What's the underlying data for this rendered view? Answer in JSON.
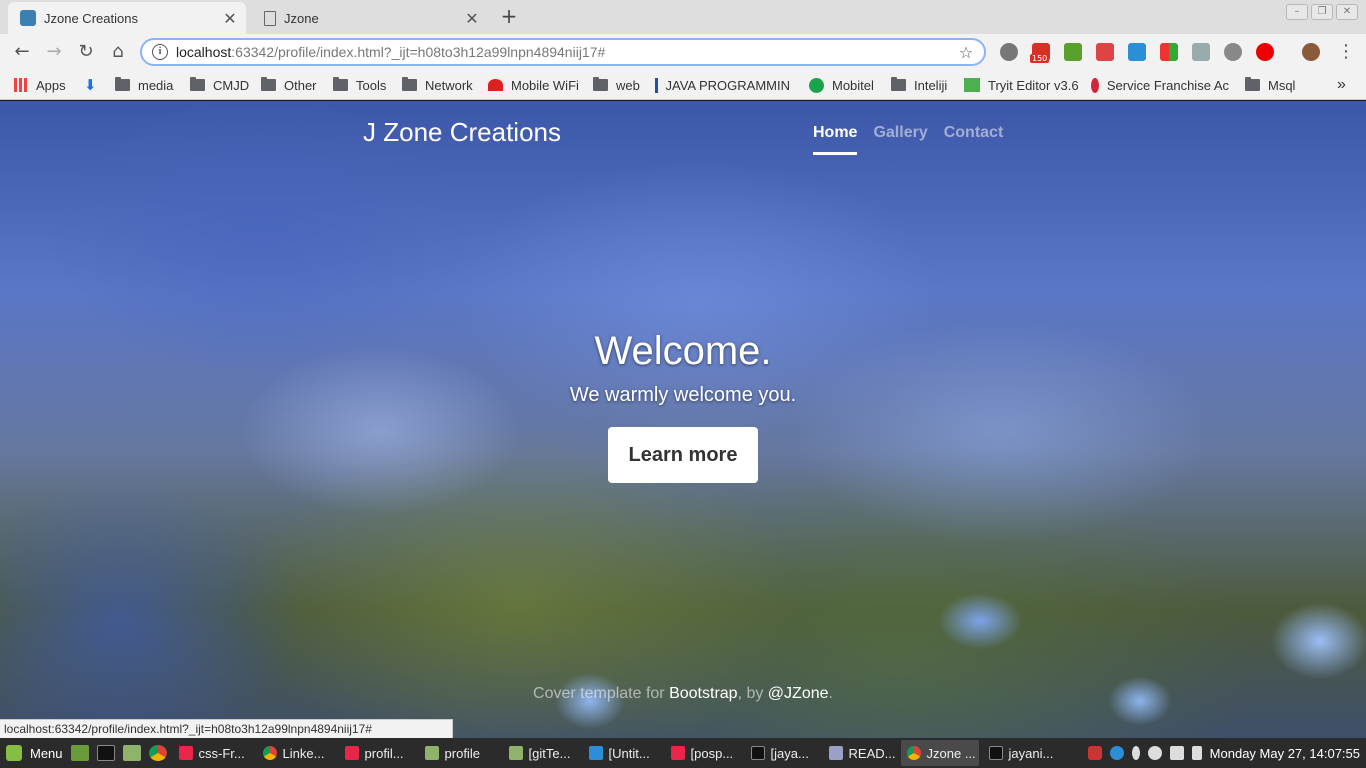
{
  "tabs": [
    {
      "title": "Jzone Creations",
      "active": true
    },
    {
      "title": "Jzone",
      "active": false
    }
  ],
  "new_tab_symbol": "+",
  "address": {
    "host": "localhost",
    "path": ":63342/profile/index.html?_ijt=h08to3h12a99lnpn4894niij17#"
  },
  "bookmarks": [
    "Apps",
    "media",
    "CMJD",
    "Other",
    "Tools",
    "Network",
    "Mobile WiFi",
    "web",
    "JAVA PROGRAMMIN",
    "Mobitel",
    "Inteliji",
    "Tryit Editor v3.6",
    "Service Franchise Ac",
    "Msql"
  ],
  "bookmarks_overflow": "»",
  "gmail_badge": "150",
  "site": {
    "brand": "J Zone Creations",
    "nav": [
      "Home",
      "Gallery",
      "Contact"
    ],
    "heading": "Welcome.",
    "lead": "We warmly welcome you.",
    "button": "Learn more",
    "footer_prefix": "Cover template for ",
    "footer_link1": "Bootstrap",
    "footer_mid": ", by ",
    "footer_link2": "@JZone",
    "footer_suffix": "."
  },
  "status_url": "localhost:63342/profile/index.html?_ijt=h08to3h12a99lnpn4894niij17#",
  "taskbar": {
    "menu": "Menu",
    "tasks": [
      "css-Fr...",
      "Linke...",
      "profil...",
      "profile",
      "[gitTe...",
      "[Untit...",
      "[posp...",
      "[jaya...",
      "READ...",
      "Jzone ...",
      "jayani..."
    ],
    "clock": "Monday May 27, 14:07:55"
  }
}
